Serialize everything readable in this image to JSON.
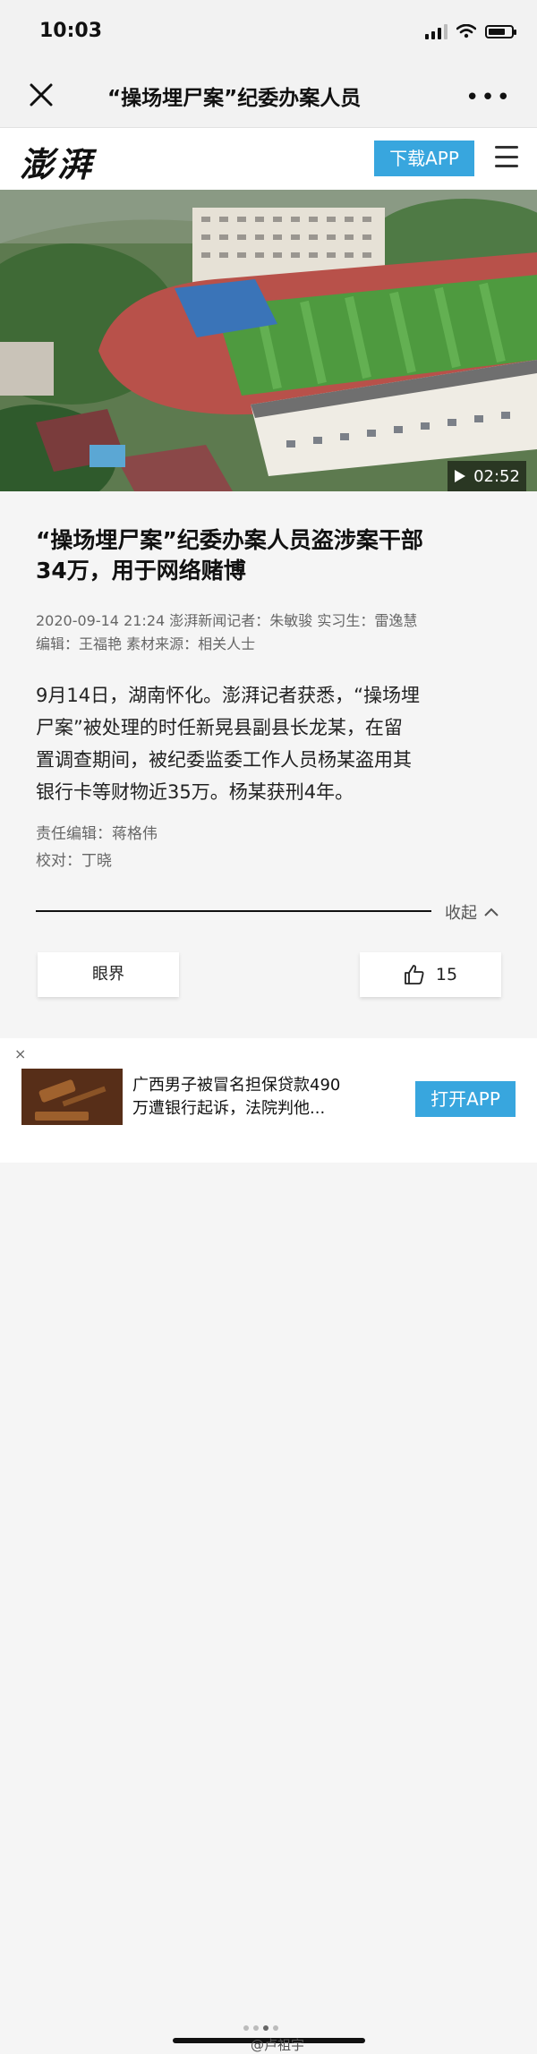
{
  "status": {
    "time": "10:03"
  },
  "nav": {
    "title": "“操场埋尸案”纪委办案人员"
  },
  "header": {
    "logo": "澎湃",
    "download_label": "下载APP"
  },
  "hero": {
    "video_duration": "02:52"
  },
  "article": {
    "headline_line1": "“操场埋尸案”纪委办案人员盗涉案干部",
    "headline_line2": "34万，用于网络赌博",
    "meta_line1": "2020-09-14 21:24  澎湃新闻记者：朱敏骏 实习生：雷逸慧",
    "meta_line2": "编辑：王福艳 素材来源：相关人士",
    "body_line1": "9月14日，湖南怀化。澎湃记者获悉，“操场埋",
    "body_line2": "尸案”被处理的时任新晃县副县长龙某，在留",
    "body_line3": "置调查期间，被纪委监委工作人员杨某盗用其",
    "body_line4": "银行卡等财物近35万。杨某获刑4年。",
    "editor": "责任编辑：蒋格伟",
    "proofreader": "校对：丁晓",
    "collapse_label": "收起",
    "tag_label": "眼界",
    "like_count": "15"
  },
  "ad": {
    "close": "×",
    "title_line1": "广西男子被冒名担保贷款490",
    "title_line2": "万遭银行起诉，法院判他...",
    "open_label": "打开APP"
  },
  "watermark": "@卢祖宇",
  "colors": {
    "accent": "#38a6de"
  }
}
